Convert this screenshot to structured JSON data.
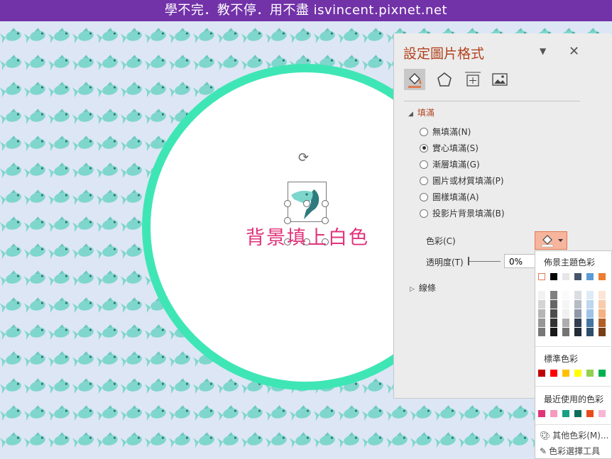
{
  "banner": {
    "text": "學不完．教不停．用不盡 isvincent.pixnet.net"
  },
  "slide": {
    "caption": "背景填上白色"
  },
  "panel": {
    "title": "設定圖片格式",
    "fill_section": "填滿",
    "fill_options": [
      "無填滿(N)",
      "實心填滿(S)",
      "漸層填滿(G)",
      "圖片或材質填滿(P)",
      "圖樣填滿(A)",
      "投影片背景填滿(B)"
    ],
    "selected_fill_index": 1,
    "color_label": "色彩(C)",
    "transparency_label": "透明度(T)",
    "transparency_value": "0%",
    "lines_section": "線條"
  },
  "palette": {
    "theme_heading": "佈景主題色彩",
    "theme_colors": [
      "#ffffff",
      "#000000",
      "#e7e6e6",
      "#44546a",
      "#5b9bd5",
      "#ed7d31"
    ],
    "standard_heading": "標準色彩",
    "standard_colors": [
      "#c00000",
      "#ff0000",
      "#ffc000",
      "#ffff00",
      "#92d050",
      "#00b050"
    ],
    "recent_heading": "最近使用的色彩",
    "recent_colors": [
      "#e0337a",
      "#f49bc1",
      "#16a085",
      "#0b6e5a",
      "#e84c1c",
      "#f6b5d5"
    ],
    "more_colors": "其他色彩(M)...",
    "eyedropper": "色彩選擇工具"
  }
}
